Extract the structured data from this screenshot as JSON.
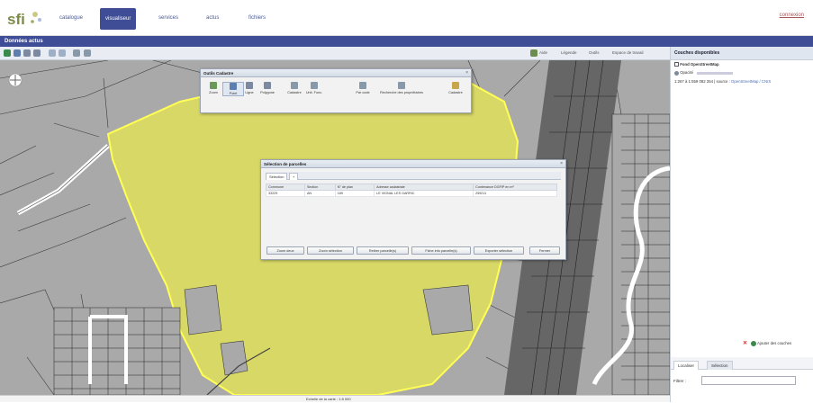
{
  "nav": {
    "tabs": [
      {
        "label": "catalogue"
      },
      {
        "label": "visualiseur"
      },
      {
        "label": "services"
      },
      {
        "label": "actus"
      },
      {
        "label": "fichiers"
      }
    ],
    "right_link": "connexion"
  },
  "titlebar": {
    "title": "Données actus"
  },
  "toolbar": {
    "right_items": [
      "Aide",
      "Légende",
      "Outils",
      "Espace de travail"
    ]
  },
  "right_panel": {
    "header": "Couches disponibles",
    "layer_name": "Fond OpenStreetMap",
    "opacity_label": "Opacité",
    "source_line": "1:267 à 1:559 082 264 | source :",
    "source_link": "OpenStreetMap / CNIS",
    "actions": {
      "remove": "Supprimer",
      "add": "Ajouter des couches"
    },
    "tabs": [
      "Localiser",
      "Sélection"
    ],
    "filter_label": "Filtrer :"
  },
  "cadastre_window": {
    "title": "Outils Cadastre",
    "tools": [
      "Zoom",
      "Point",
      "Ligne",
      "Polygone",
      "Cadastre",
      "Unit. Fonc.",
      "Par code",
      "Recherche des propriétaires",
      "Cadastre"
    ]
  },
  "selection_window": {
    "title": "Sélection de parcelles",
    "tabs": [
      "Sélection",
      "+"
    ],
    "columns": [
      "Commune",
      "Section",
      "N° de plan",
      "Adresse cadastrale",
      "Contenance DGFIP en m²"
    ],
    "rows": [
      [
        "33229",
        "AN",
        "189",
        "LE VIGNAL LES GARRIC",
        "259211"
      ]
    ],
    "buttons": [
      "Zoom deux",
      "Zoom sélection",
      "Retirer parcelle(s)",
      "Fiche info parcelle(s)",
      "Exporter sélection",
      "Fermer"
    ]
  },
  "status": {
    "scale": "Echelle de la carte : 1:5 000"
  },
  "colors": {
    "nav_accent": "#3e4d95",
    "parcel_fill": "#d8d867",
    "parcel_stroke": "#ffff55",
    "map_bg": "#a9a9a9"
  }
}
